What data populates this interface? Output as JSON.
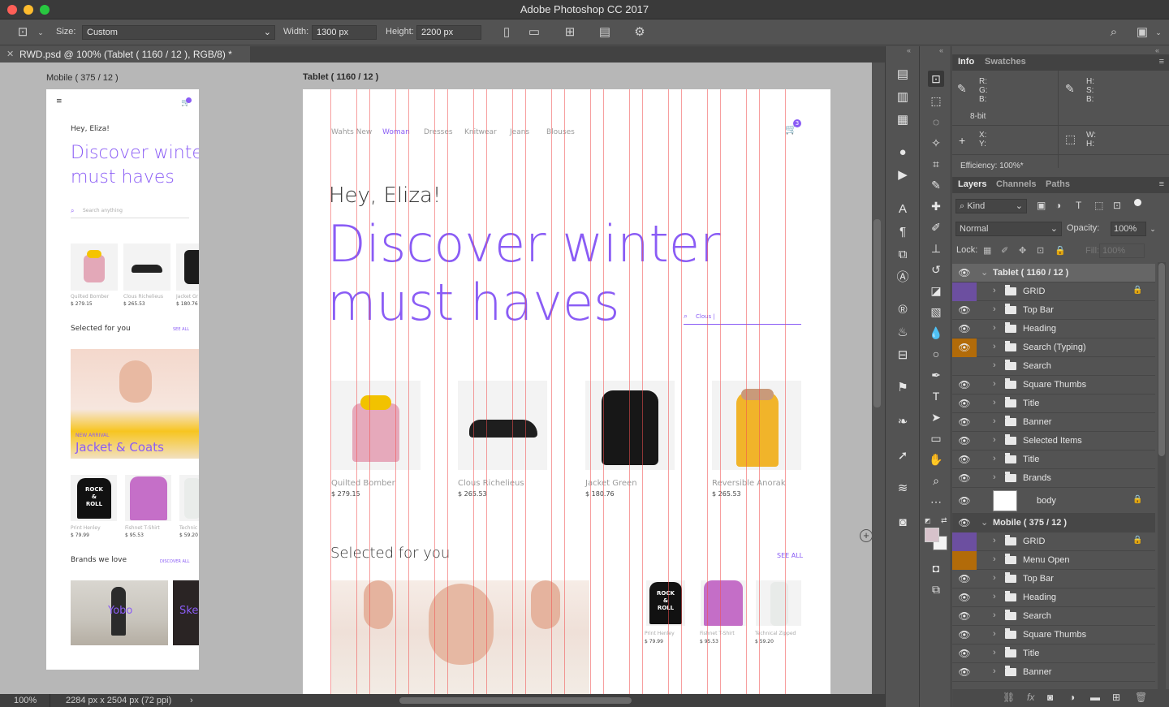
{
  "window": {
    "title": "Adobe Photoshop CC 2017"
  },
  "options": {
    "size_label": "Size:",
    "size_value": "Custom",
    "width_label": "Width:",
    "width_value": "1300 px",
    "height_label": "Height:",
    "height_value": "2200 px"
  },
  "document": {
    "tab_title": "RWD.psd @ 100% (Tablet ( 1160 / 12 ), RGB/8) *"
  },
  "artboards": {
    "mobile_label": "Mobile ( 375 / 12 )",
    "tablet_label": "Tablet ( 1160 / 12 )"
  },
  "tablet": {
    "nav": [
      "Wahts New",
      "Woman",
      "Dresses",
      "Knitwear",
      "Jeans",
      "Blouses"
    ],
    "cart_count": "3",
    "greeting": "Hey, Eliza!",
    "headline_1": "Discover winter",
    "headline_2": "must haves",
    "search_value": "Clous |",
    "products": [
      {
        "name": "Quilted Bomber",
        "price": "$ 279.15"
      },
      {
        "name": "Clous Richelieus",
        "price": "$ 265.53"
      },
      {
        "name": "Jacket Green",
        "price": "$ 180.76"
      },
      {
        "name": "Reversible Anorak",
        "price": "$ 265.53"
      }
    ],
    "selected_title": "Selected for you",
    "see_all": "SEE ALL",
    "small_products": [
      {
        "name": "Print Henley",
        "price": "$ 79.99"
      },
      {
        "name": "Fishnet T-Shirt",
        "price": "$ 95.53"
      },
      {
        "name": "Technical Zipped",
        "price": "$ 59.20"
      }
    ],
    "tee_text": [
      "ROCK",
      "&",
      "ROLL"
    ]
  },
  "mobile": {
    "greeting": "Hey, Eliza!",
    "headline_1": "Discover winter",
    "headline_2": "must haves",
    "search_placeholder": "Search anything",
    "products": [
      {
        "name": "Quilted Bomber",
        "price": "$ 279.15"
      },
      {
        "name": "Clous Richelieus",
        "price": "$ 265.53"
      },
      {
        "name": "Jacket Gr",
        "price": "$ 180.76"
      }
    ],
    "selected_title": "Selected for you",
    "see_all": "SEE ALL",
    "banner_tag": "NEW ARRIVAL",
    "banner_title": "Jacket & Coats",
    "small_products": [
      {
        "name": "Print Henley",
        "price": "$ 79.99"
      },
      {
        "name": "Fishnet T-Shirt",
        "price": "$ 95.53"
      },
      {
        "name": "Technic",
        "price": "$ 59.20"
      }
    ],
    "tee_text": [
      "ROCK",
      "&",
      "ROLL"
    ],
    "brands_title": "Brands we love",
    "discover_all": "DISCOVER ALL",
    "brands": [
      "Yobo",
      "Ske"
    ]
  },
  "status": {
    "zoom": "100%",
    "doc_info": "2284 px x 2504 px (72 ppi)"
  },
  "info_panel": {
    "tabs": [
      "Info",
      "Swatches"
    ],
    "rgb_labels": "R:\nG:\nB:",
    "hsb_labels": "H:\nS:\nB:",
    "bit_depth": "8-bit",
    "xy_labels": "X:\nY:",
    "wh_labels": "W:\nH:",
    "efficiency": "Efficiency: 100%*"
  },
  "layers_panel": {
    "tabs": [
      "Layers",
      "Channels",
      "Paths"
    ],
    "filter_kind": "Kind",
    "blend_mode": "Normal",
    "opacity_label": "Opacity:",
    "opacity_value": "100%",
    "lock_label": "Lock:",
    "fill_label": "Fill:",
    "fill_value": "100%",
    "tablet_group": "Tablet ( 1160 / 12 )",
    "tablet_layers": [
      "GRID",
      "Top Bar",
      "Heading",
      "Search (Typing)",
      "Search",
      "Square Thumbs",
      "Title",
      "Banner",
      "Selected Items",
      "Title",
      "Brands"
    ],
    "body_layer": "body",
    "mobile_group": "Mobile ( 375 / 12 )",
    "mobile_layers": [
      "GRID",
      "Menu Open",
      "Top Bar",
      "Heading",
      "Search",
      "Square Thumbs",
      "Title",
      "Banner"
    ]
  },
  "colors": {
    "accent_purple": "#8a5cf5",
    "grid_red": "#f05050",
    "layer_purple": "#6c4fa0",
    "layer_orange": "#b26b09"
  }
}
